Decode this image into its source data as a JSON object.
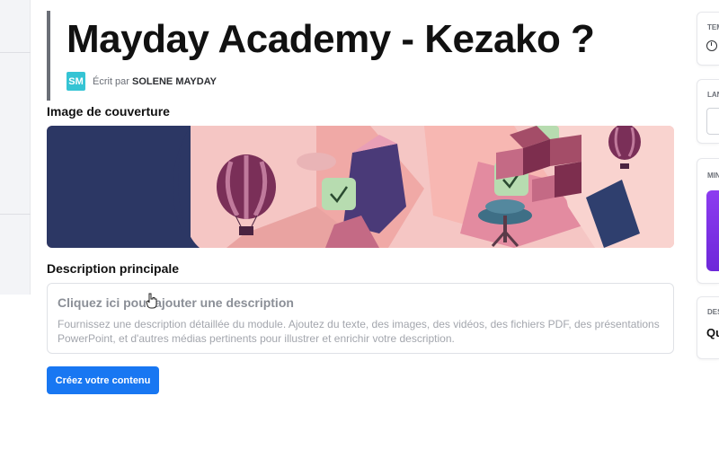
{
  "page": {
    "title": "Mayday Academy - Kezako ?",
    "author": {
      "initials": "SM",
      "prefix": "Écrit par",
      "name": "SOLENE MAYDAY"
    }
  },
  "cover": {
    "label": "Image de couverture"
  },
  "description": {
    "label": "Description principale",
    "placeholder": "Cliquez ici pour ajouter une description",
    "help": "Fournissez une description détaillée du module. Ajoutez du texte, des images, des vidéos, des fichiers PDF, des présentations PowerPoint, et d'autres médias pertinents pour illustrer et enrichir votre description."
  },
  "actions": {
    "create_label": "Créez votre contenu"
  },
  "right_panel": {
    "card1_label": "TEM",
    "card2_label": "LAN",
    "card3_label": "MIN",
    "card4_label": "DES",
    "card4_value": "Qu"
  },
  "colors": {
    "accent": "#1877f2",
    "avatar": "#35c4d4",
    "purple": "#7c3aed"
  },
  "icons": {
    "clock": "clock-icon",
    "cursor": "hand-pointer-icon"
  }
}
